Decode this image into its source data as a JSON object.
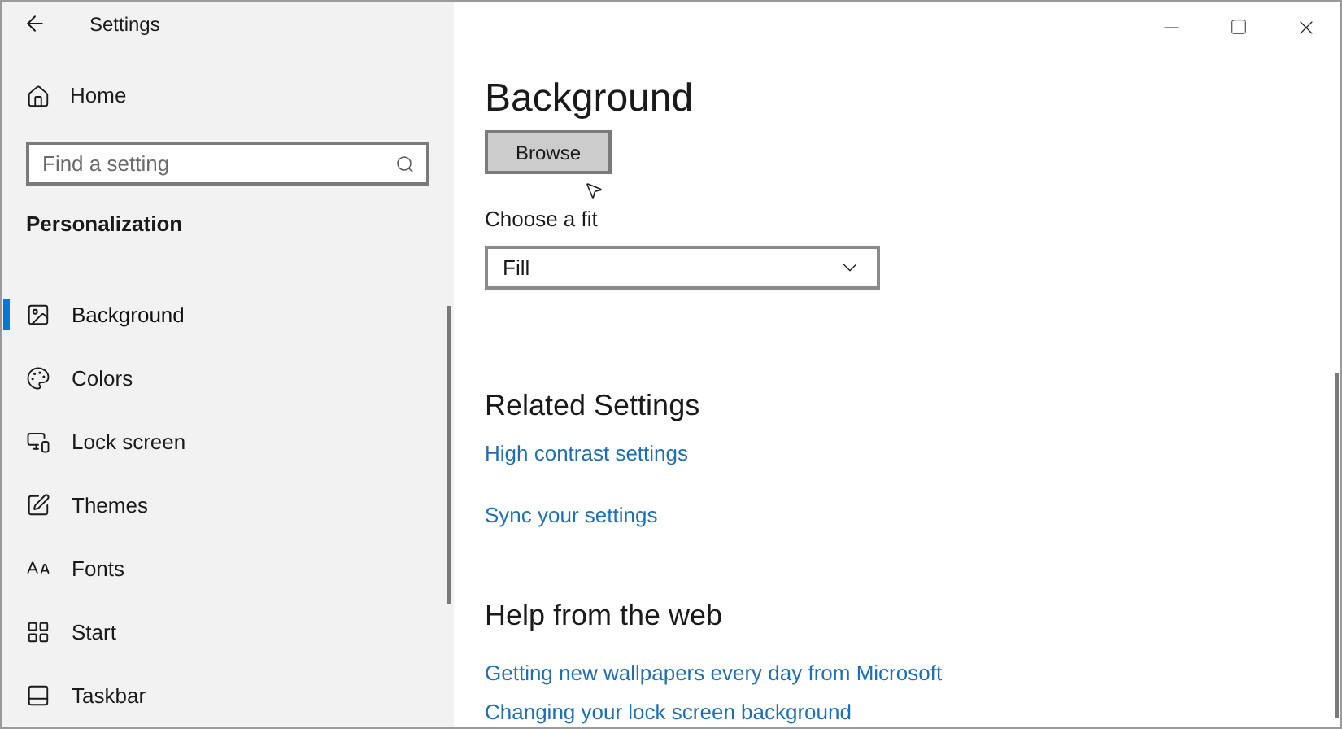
{
  "window": {
    "title": "Settings"
  },
  "sidebar": {
    "home": "Home",
    "search": {
      "placeholder": "Find a setting"
    },
    "section": "Personalization",
    "items": [
      {
        "label": "Background",
        "selected": true
      },
      {
        "label": "Colors",
        "selected": false
      },
      {
        "label": "Lock screen",
        "selected": false
      },
      {
        "label": "Themes",
        "selected": false
      },
      {
        "label": "Fonts",
        "selected": false
      },
      {
        "label": "Start",
        "selected": false
      },
      {
        "label": "Taskbar",
        "selected": false
      }
    ]
  },
  "main": {
    "title": "Background",
    "browse_button": "Browse",
    "fit": {
      "label": "Choose a fit",
      "value": "Fill"
    },
    "related": {
      "heading": "Related Settings",
      "links": [
        "High contrast settings",
        "Sync your settings"
      ]
    },
    "help": {
      "heading": "Help from the web",
      "links": [
        "Getting new wallpapers every day from Microsoft",
        "Changing your lock screen background"
      ]
    }
  }
}
